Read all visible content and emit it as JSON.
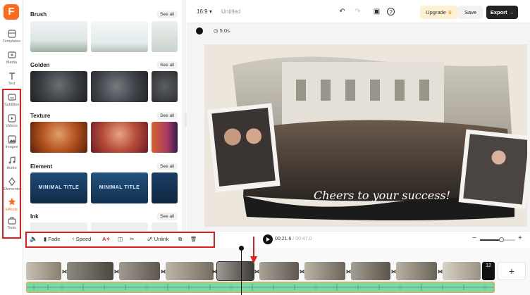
{
  "app": {
    "logo_letter": "F"
  },
  "nav": {
    "items": [
      {
        "label": "Templates",
        "icon": "templates-icon"
      },
      {
        "label": "Media",
        "icon": "media-icon"
      },
      {
        "label": "Text",
        "icon": "text-icon"
      },
      {
        "label": "Subtitles",
        "icon": "subtitles-icon"
      },
      {
        "label": "Videos",
        "icon": "videos-icon"
      },
      {
        "label": "Images",
        "icon": "images-icon"
      },
      {
        "label": "Audio",
        "icon": "audio-icon"
      },
      {
        "label": "Elements",
        "icon": "elements-icon"
      },
      {
        "label": "Effects",
        "icon": "effects-icon"
      },
      {
        "label": "Tools",
        "icon": "tools-icon"
      }
    ],
    "active": "Effects",
    "accent": "#ff6a1a"
  },
  "panel": {
    "sections": [
      {
        "title": "Brush",
        "see_all": "See all"
      },
      {
        "title": "Golden",
        "see_all": "See all"
      },
      {
        "title": "Texture",
        "see_all": "See all"
      },
      {
        "title": "Element",
        "see_all": "See all",
        "thumb_text": "MINIMAL TITLE"
      },
      {
        "title": "Ink",
        "see_all": "See all"
      }
    ]
  },
  "topbar": {
    "aspect_ratio": "16:9",
    "title": "Untitled",
    "upgrade_label": "Upgrade",
    "save_label": "Save",
    "export_label": "Export"
  },
  "canvas": {
    "color": "#111111",
    "duration": "5.0s",
    "caption": "Cheers to your success!"
  },
  "toolbar": {
    "fade_label": "Fade",
    "speed_label": "Speed",
    "unlink_label": "Unlink",
    "current_time": "00:21.6",
    "total_time": "/ 00:47.0"
  },
  "timeline": {
    "clip_count": "12",
    "add_label": "+",
    "zoom_level": 0.62
  }
}
